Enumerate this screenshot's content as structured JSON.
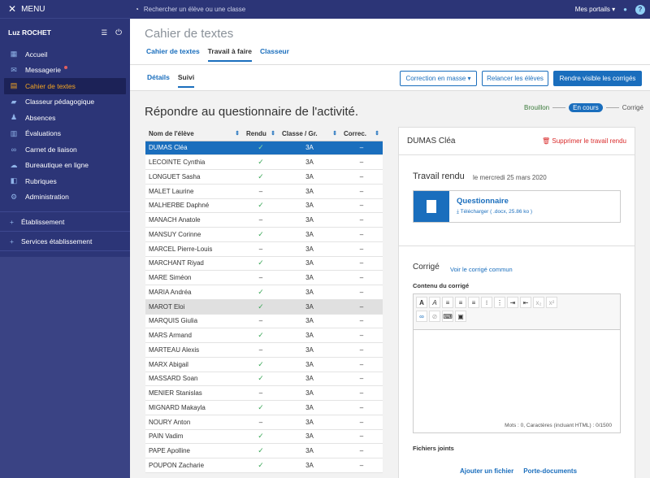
{
  "sidebar": {
    "menu_label": "MENU",
    "user": "Luz ROCHET",
    "items": [
      {
        "label": "Accueil",
        "icon": "home-icon",
        "glyph": "▦"
      },
      {
        "label": "Messagerie",
        "icon": "mail-icon",
        "glyph": "✉"
      },
      {
        "label": "Cahier de textes",
        "icon": "book-icon",
        "glyph": "▤"
      },
      {
        "label": "Classeur pédagogique",
        "icon": "folder-icon",
        "glyph": "▰"
      },
      {
        "label": "Absences",
        "icon": "person-icon",
        "glyph": "♟"
      },
      {
        "label": "Évaluations",
        "icon": "chart-icon",
        "glyph": "▥"
      },
      {
        "label": "Carnet de liaison",
        "icon": "link-icon",
        "glyph": "∞"
      },
      {
        "label": "Bureautique en ligne",
        "icon": "cloud-icon",
        "glyph": "☁"
      },
      {
        "label": "Rubriques",
        "icon": "bookmark-icon",
        "glyph": "◧"
      },
      {
        "label": "Administration",
        "icon": "gear-icon",
        "glyph": "⚙"
      }
    ],
    "sections": [
      "Établissement",
      "Services établissement"
    ]
  },
  "topbar": {
    "search_placeholder": "Rechercher un élève ou une classe",
    "portals": "Mes portails"
  },
  "header": {
    "title": "Cahier de textes",
    "tabs": [
      "Cahier de textes",
      "Travail à faire",
      "Classeur"
    ]
  },
  "subheader": {
    "tabs": [
      "Détails",
      "Suivi"
    ],
    "buttons": {
      "correction": "Correction en masse",
      "relancer": "Relancer les élèves",
      "rendre": "Rendre visible les corrigés"
    }
  },
  "main": {
    "title": "Répondre au questionnaire de l'activité.",
    "steps": [
      "Brouillon",
      "En cours",
      "Corrigé"
    ],
    "columns": [
      "Nom de l'élève",
      "Rendu",
      "Classe / Gr.",
      "Correc."
    ],
    "students": [
      {
        "name": "DUMAS Cléa",
        "rendu": true,
        "classe": "3A",
        "correc": "–"
      },
      {
        "name": "LECOINTE Cynthia",
        "rendu": true,
        "classe": "3A",
        "correc": "–"
      },
      {
        "name": "LONGUET Sasha",
        "rendu": true,
        "classe": "3A",
        "correc": "–"
      },
      {
        "name": "MALET Laurine",
        "rendu": false,
        "classe": "3A",
        "correc": "–"
      },
      {
        "name": "MALHERBE Daphné",
        "rendu": true,
        "classe": "3A",
        "correc": "–"
      },
      {
        "name": "MANACH Anatole",
        "rendu": false,
        "classe": "3A",
        "correc": "–"
      },
      {
        "name": "MANSUY Corinne",
        "rendu": true,
        "classe": "3A",
        "correc": "–"
      },
      {
        "name": "MARCEL Pierre-Louis",
        "rendu": false,
        "classe": "3A",
        "correc": "–"
      },
      {
        "name": "MARCHANT Riyad",
        "rendu": true,
        "classe": "3A",
        "correc": "–"
      },
      {
        "name": "MARE Siméon",
        "rendu": false,
        "classe": "3A",
        "correc": "–"
      },
      {
        "name": "MARIA Andréa",
        "rendu": true,
        "classe": "3A",
        "correc": "–"
      },
      {
        "name": "MAROT Eloi",
        "rendu": true,
        "classe": "3A",
        "correc": "–"
      },
      {
        "name": "MARQUIS Giulia",
        "rendu": false,
        "classe": "3A",
        "correc": "–"
      },
      {
        "name": "MARS Armand",
        "rendu": true,
        "classe": "3A",
        "correc": "–"
      },
      {
        "name": "MARTEAU Alexis",
        "rendu": false,
        "classe": "3A",
        "correc": "–"
      },
      {
        "name": "MARX Abigail",
        "rendu": true,
        "classe": "3A",
        "correc": "–"
      },
      {
        "name": "MASSARD Soan",
        "rendu": true,
        "classe": "3A",
        "correc": "–"
      },
      {
        "name": "MENIER Stanislas",
        "rendu": false,
        "classe": "3A",
        "correc": "–"
      },
      {
        "name": "MIGNARD Makayla",
        "rendu": true,
        "classe": "3A",
        "correc": "–"
      },
      {
        "name": "NOURY Anton",
        "rendu": false,
        "classe": "3A",
        "correc": "–"
      },
      {
        "name": "PAIN Vadim",
        "rendu": true,
        "classe": "3A",
        "correc": "–"
      },
      {
        "name": "PAPE Apolline",
        "rendu": true,
        "classe": "3A",
        "correc": "–"
      },
      {
        "name": "POUPON Zacharie",
        "rendu": true,
        "classe": "3A",
        "correc": "–"
      }
    ]
  },
  "panel": {
    "student_name": "DUMAS Cléa",
    "delete": "Supprimer le travail rendu",
    "travail_title": "Travail rendu",
    "travail_date": "le mercredi 25 mars 2020",
    "file_name": "Questionnaire",
    "file_download": "Télécharger ( .docx, 25.86 ko )",
    "corrige_title": "Corrigé",
    "corrige_link": "Voir le corrigé commun",
    "content_label": "Contenu du corrigé",
    "counter": "Mots : 0, Caractères (incluant HTML) : 0/1500",
    "fichiers_label": "Fichiers joints",
    "add_file": "Ajouter un fichier",
    "porte_docs": "Porte-documents"
  },
  "colors": {
    "accent": "#1a6ebd",
    "sidebar": "#2c3577",
    "active": "#f5a623",
    "danger": "#d92b2b"
  }
}
